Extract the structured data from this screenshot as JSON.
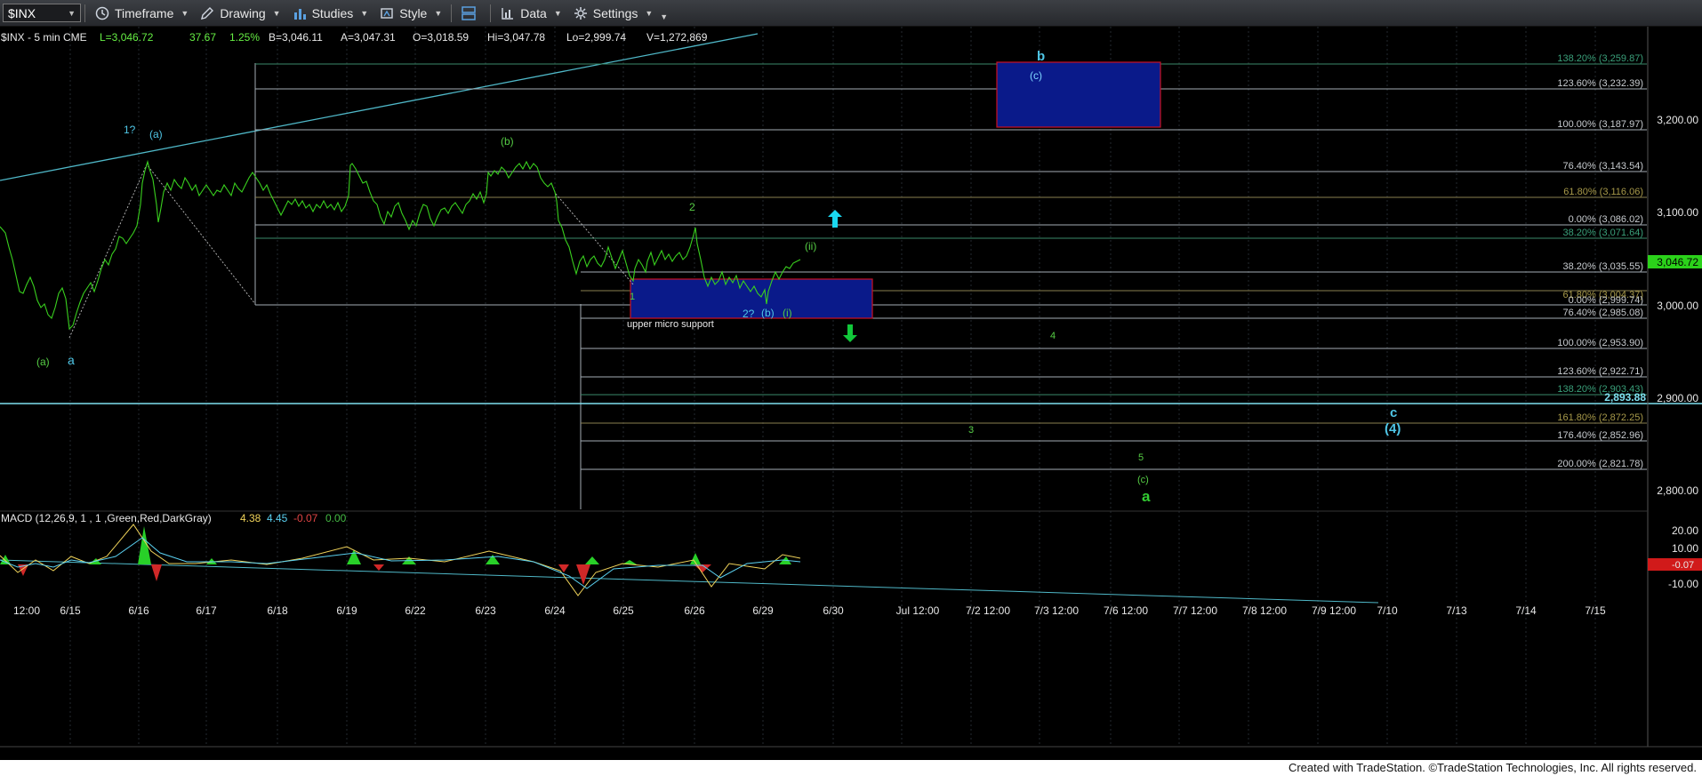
{
  "toolbar": {
    "symbol": "$INX",
    "items": [
      "Timeframe",
      "Drawing",
      "Studies",
      "Style",
      "Data",
      "Settings"
    ]
  },
  "header": {
    "label": "$INX - 5 min  CME",
    "last": "L=3,046.72",
    "change": "37.67",
    "pct": "1.25%",
    "bid": "B=3,046.11",
    "ask": "A=3,047.31",
    "open": "O=3,018.59",
    "high": "Hi=3,047.78",
    "low": "Lo=2,999.74",
    "volume": "V=1,272,869"
  },
  "colors": {
    "background": "#000000",
    "price": "#44dd33",
    "wave_green": "#55cc44",
    "wave_cyan": "#55c8ee",
    "target_box": "#0a1a8a",
    "box_border": "#cc1122",
    "fib_line": "#9aa6b0"
  },
  "price_axis": {
    "ticks": [
      "3,200.00",
      "3,100.00",
      "3,000.00",
      "2,900.00",
      "2,800.00"
    ],
    "last_price": "3,046.72",
    "support_price": "2,893.88"
  },
  "macd": {
    "title": "MACD (12,26,9, 1 , 1 ,Green,Red,DarkGray)",
    "v1": "4.38",
    "v2": "4.45",
    "v3": "-0.07",
    "v4": "0.00",
    "ticks": [
      "20.00",
      "10.00",
      "-10.00"
    ],
    "badge": "-0.07"
  },
  "time_axis": [
    "12:00",
    "6/15",
    "6/16",
    "6/17",
    "6/18",
    "6/19",
    "6/22",
    "6/23",
    "6/24",
    "6/25",
    "6/26",
    "6/29",
    "6/30",
    "Jul 12:00",
    "7/2 12:00",
    "7/3 12:00",
    "7/6 12:00",
    "7/7 12:00",
    "7/8 12:00",
    "7/9 12:00",
    "7/10",
    "7/13",
    "7/14",
    "7/15"
  ],
  "fib_labels": {
    "f1382_top": "138.20% (3,259.87)",
    "f1236_top": "123.60% (3,232.39)",
    "f100_top": "100.00% (3,187.97)",
    "f764_top": "76.40% (3,143.54)",
    "f618_top": "61.80% (3,116.06)",
    "f0_top": "0.00% (3,086.02)",
    "f382_top": "38.20% (3,071.64)",
    "f382_low": "38.20% (3,035.55)",
    "f618_low": "61.80% (3,004.37)",
    "f0_low": "0.00% (2,999.74)",
    "f764_low": "76.40% (2,985.08)",
    "f100_low": "100.00% (2,953.90)",
    "f1236_low": "123.60% (2,922.71)",
    "f1382_low": "138.20% (2,903.43)",
    "f1618_low": "161.80% (2,872.25)",
    "f1764_low": "176.40% (2,852.96)",
    "f200_low": "200.00% (2,821.78)"
  },
  "wave_labels": {
    "b_top": "b",
    "c_in_box": "(c)",
    "one_q": "1?",
    "a_paren_1": "(a)",
    "b_paren": "(b)",
    "two": "2",
    "ii": "(ii)",
    "one": "1",
    "two_q": "2?",
    "b_paren_2": "(b)",
    "i": "(i)",
    "a_paren_low": "(a)",
    "a_low": "a",
    "four": "4",
    "three": "3",
    "five": "5",
    "c_paren": "(c)",
    "a_big": "a",
    "c_big": "c",
    "four_big": "(4)"
  },
  "annotations": {
    "support": "upper micro support"
  },
  "footer": "Created with TradeStation. ©TradeStation Technologies, Inc. All rights reserved."
}
